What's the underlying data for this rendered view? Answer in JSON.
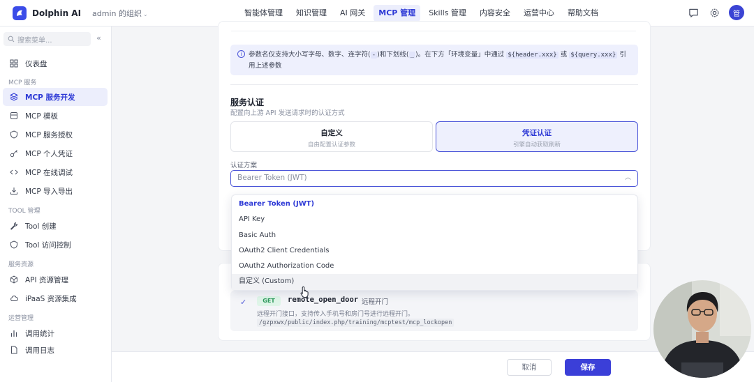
{
  "app": {
    "name": "Dolphin AI",
    "org": "admin 的组织"
  },
  "nav": [
    {
      "label": "智能体管理",
      "active": false
    },
    {
      "label": "知识管理",
      "active": false
    },
    {
      "label": "AI 网关",
      "active": false
    },
    {
      "label": "MCP 管理",
      "active": true
    },
    {
      "label": "Skills 管理",
      "active": false
    },
    {
      "label": "内容安全",
      "active": false
    },
    {
      "label": "运营中心",
      "active": false
    },
    {
      "label": "帮助文档",
      "active": false
    }
  ],
  "user": {
    "avatar": "管"
  },
  "sidebar": {
    "search_placeholder": "搜索菜单...",
    "dashboard": "仪表盘",
    "groups": {
      "mcp": "MCP 服务",
      "tool": "TOOL 管理",
      "resource": "服务资源",
      "ops": "运营管理"
    },
    "items": {
      "mcp_dev": "MCP 服务开发",
      "mcp_template": "MCP 模板",
      "mcp_auth": "MCP 服务授权",
      "mcp_credential": "MCP 个人凭证",
      "mcp_debug": "MCP 在线调试",
      "mcp_import": "MCP 导入导出",
      "tool_create": "Tool 创建",
      "tool_access": "Tool 访问控制",
      "api_resource": "API 资源管理",
      "ipaas": "iPaaS 资源集成",
      "call_stats": "调用统计",
      "call_log": "调用日志"
    }
  },
  "notice": {
    "text1": "参数名仅支持大小写字母、数字、连字符(",
    "hyphen": "-",
    "text2": ")和下划线(",
    "underscore": "_",
    "text3": ")。在下方「环境变量」中通过",
    "code1": "${header.xxx}",
    "or": "或",
    "code2": "${query.xxx}",
    "text4": "引用上述参数"
  },
  "auth": {
    "title": "服务认证",
    "subtitle": "配置向上游 API 发送请求时的认证方式",
    "options": [
      {
        "title": "自定义",
        "desc": "自由配置认证参数"
      },
      {
        "title": "凭证认证",
        "desc": "引擎自动获取刷新"
      }
    ],
    "scheme_label": "认证方案",
    "scheme_value": "Bearer Token (JWT)",
    "dropdown": [
      "Bearer Token (JWT)",
      "API Key",
      "Basic Auth",
      "OAuth2 Client Credentials",
      "OAuth2 Authorization Code",
      "自定义 (Custom)"
    ]
  },
  "tool": {
    "method": "GET",
    "name": "remote_open_door",
    "label": "远程开门",
    "desc": "远程开门接口，支持传入手机号和房门号进行远程开门。",
    "path": "/gzpxwx/public/index.php/training/mcptest/mcp_lockopen"
  },
  "footer": {
    "cancel": "取消",
    "save": "保存"
  },
  "colors": {
    "accent": "#3b3fd8",
    "accent_bg": "#eceefc",
    "get_badge": "#2e9a5c"
  }
}
